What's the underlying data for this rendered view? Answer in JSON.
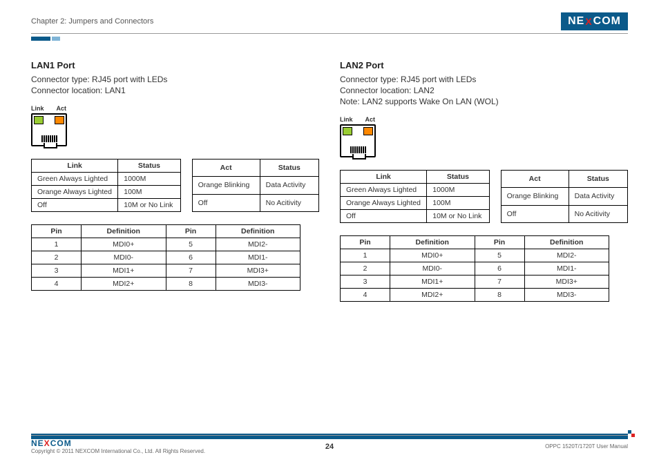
{
  "header": {
    "chapter": "Chapter 2: Jumpers and Connectors",
    "logo": {
      "pre": "NE",
      "x": "X",
      "post": "COM"
    }
  },
  "lan1": {
    "title": "LAN1 Port",
    "type_line": "Connector type: RJ45 port with LEDs",
    "loc_line": "Connector location: LAN1",
    "label_link": "Link",
    "label_act": "Act",
    "link_table": {
      "h1": "Link",
      "h2": "Status",
      "rows": [
        {
          "c1": "Green Always Lighted",
          "c2": "1000M"
        },
        {
          "c1": "Orange Always Lighted",
          "c2": "100M"
        },
        {
          "c1": "Off",
          "c2": "10M or No Link"
        }
      ]
    },
    "act_table": {
      "h1": "Act",
      "h2": "Status",
      "rows": [
        {
          "c1": "Orange Blinking",
          "c2": "Data Activity"
        },
        {
          "c1": "Off",
          "c2": "No Acitivity"
        }
      ]
    },
    "pin_table": {
      "h1": "Pin",
      "h2": "Definition",
      "h3": "Pin",
      "h4": "Definition",
      "rows": [
        {
          "c1": "1",
          "c2": "MDI0+",
          "c3": "5",
          "c4": "MDI2-"
        },
        {
          "c1": "2",
          "c2": "MDI0-",
          "c3": "6",
          "c4": "MDI1-"
        },
        {
          "c1": "3",
          "c2": "MDI1+",
          "c3": "7",
          "c4": "MDI3+"
        },
        {
          "c1": "4",
          "c2": "MDI2+",
          "c3": "8",
          "c4": "MDI3-"
        }
      ]
    }
  },
  "lan2": {
    "title": "LAN2 Port",
    "type_line": "Connector type: RJ45 port with LEDs",
    "loc_line": "Connector location: LAN2",
    "note_line": "Note: LAN2 supports Wake On LAN (WOL)",
    "label_link": "Link",
    "label_act": "Act",
    "link_table": {
      "h1": "Link",
      "h2": "Status",
      "rows": [
        {
          "c1": "Green Always Lighted",
          "c2": "1000M"
        },
        {
          "c1": "Orange Always Lighted",
          "c2": "100M"
        },
        {
          "c1": "Off",
          "c2": "10M or No Link"
        }
      ]
    },
    "act_table": {
      "h1": "Act",
      "h2": "Status",
      "rows": [
        {
          "c1": "Orange Blinking",
          "c2": "Data Activity"
        },
        {
          "c1": "Off",
          "c2": "No Acitivity"
        }
      ]
    },
    "pin_table": {
      "h1": "Pin",
      "h2": "Definition",
      "h3": "Pin",
      "h4": "Definition",
      "rows": [
        {
          "c1": "1",
          "c2": "MDI0+",
          "c3": "5",
          "c4": "MDI2-"
        },
        {
          "c1": "2",
          "c2": "MDI0-",
          "c3": "6",
          "c4": "MDI1-"
        },
        {
          "c1": "3",
          "c2": "MDI1+",
          "c3": "7",
          "c4": "MDI3+"
        },
        {
          "c1": "4",
          "c2": "MDI2+",
          "c3": "8",
          "c4": "MDI3-"
        }
      ]
    }
  },
  "footer": {
    "copyright": "Copyright © 2011 NEXCOM International Co., Ltd. All Rights Reserved.",
    "page": "24",
    "manual": "OPPC 1520T/1720T User Manual",
    "logo": {
      "pre": "NE",
      "x": "X",
      "post": "COM"
    }
  }
}
